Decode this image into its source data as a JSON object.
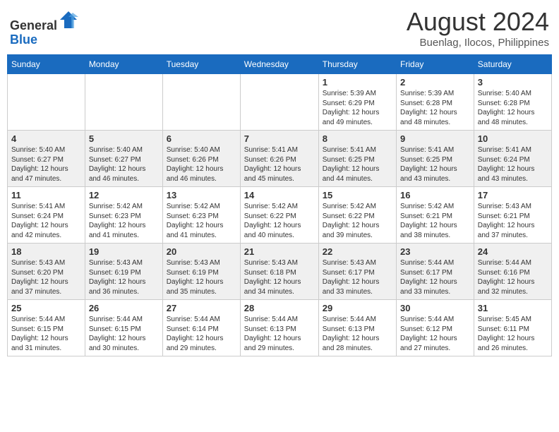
{
  "header": {
    "logo_line1": "General",
    "logo_line2": "Blue",
    "month_title": "August 2024",
    "location": "Buenlag, Ilocos, Philippines"
  },
  "weekdays": [
    "Sunday",
    "Monday",
    "Tuesday",
    "Wednesday",
    "Thursday",
    "Friday",
    "Saturday"
  ],
  "weeks": [
    [
      {
        "day": "",
        "info": ""
      },
      {
        "day": "",
        "info": ""
      },
      {
        "day": "",
        "info": ""
      },
      {
        "day": "",
        "info": ""
      },
      {
        "day": "1",
        "info": "Sunrise: 5:39 AM\nSunset: 6:29 PM\nDaylight: 12 hours\nand 49 minutes."
      },
      {
        "day": "2",
        "info": "Sunrise: 5:39 AM\nSunset: 6:28 PM\nDaylight: 12 hours\nand 48 minutes."
      },
      {
        "day": "3",
        "info": "Sunrise: 5:40 AM\nSunset: 6:28 PM\nDaylight: 12 hours\nand 48 minutes."
      }
    ],
    [
      {
        "day": "4",
        "info": "Sunrise: 5:40 AM\nSunset: 6:27 PM\nDaylight: 12 hours\nand 47 minutes."
      },
      {
        "day": "5",
        "info": "Sunrise: 5:40 AM\nSunset: 6:27 PM\nDaylight: 12 hours\nand 46 minutes."
      },
      {
        "day": "6",
        "info": "Sunrise: 5:40 AM\nSunset: 6:26 PM\nDaylight: 12 hours\nand 46 minutes."
      },
      {
        "day": "7",
        "info": "Sunrise: 5:41 AM\nSunset: 6:26 PM\nDaylight: 12 hours\nand 45 minutes."
      },
      {
        "day": "8",
        "info": "Sunrise: 5:41 AM\nSunset: 6:25 PM\nDaylight: 12 hours\nand 44 minutes."
      },
      {
        "day": "9",
        "info": "Sunrise: 5:41 AM\nSunset: 6:25 PM\nDaylight: 12 hours\nand 43 minutes."
      },
      {
        "day": "10",
        "info": "Sunrise: 5:41 AM\nSunset: 6:24 PM\nDaylight: 12 hours\nand 43 minutes."
      }
    ],
    [
      {
        "day": "11",
        "info": "Sunrise: 5:41 AM\nSunset: 6:24 PM\nDaylight: 12 hours\nand 42 minutes."
      },
      {
        "day": "12",
        "info": "Sunrise: 5:42 AM\nSunset: 6:23 PM\nDaylight: 12 hours\nand 41 minutes."
      },
      {
        "day": "13",
        "info": "Sunrise: 5:42 AM\nSunset: 6:23 PM\nDaylight: 12 hours\nand 41 minutes."
      },
      {
        "day": "14",
        "info": "Sunrise: 5:42 AM\nSunset: 6:22 PM\nDaylight: 12 hours\nand 40 minutes."
      },
      {
        "day": "15",
        "info": "Sunrise: 5:42 AM\nSunset: 6:22 PM\nDaylight: 12 hours\nand 39 minutes."
      },
      {
        "day": "16",
        "info": "Sunrise: 5:42 AM\nSunset: 6:21 PM\nDaylight: 12 hours\nand 38 minutes."
      },
      {
        "day": "17",
        "info": "Sunrise: 5:43 AM\nSunset: 6:21 PM\nDaylight: 12 hours\nand 37 minutes."
      }
    ],
    [
      {
        "day": "18",
        "info": "Sunrise: 5:43 AM\nSunset: 6:20 PM\nDaylight: 12 hours\nand 37 minutes."
      },
      {
        "day": "19",
        "info": "Sunrise: 5:43 AM\nSunset: 6:19 PM\nDaylight: 12 hours\nand 36 minutes."
      },
      {
        "day": "20",
        "info": "Sunrise: 5:43 AM\nSunset: 6:19 PM\nDaylight: 12 hours\nand 35 minutes."
      },
      {
        "day": "21",
        "info": "Sunrise: 5:43 AM\nSunset: 6:18 PM\nDaylight: 12 hours\nand 34 minutes."
      },
      {
        "day": "22",
        "info": "Sunrise: 5:43 AM\nSunset: 6:17 PM\nDaylight: 12 hours\nand 33 minutes."
      },
      {
        "day": "23",
        "info": "Sunrise: 5:44 AM\nSunset: 6:17 PM\nDaylight: 12 hours\nand 33 minutes."
      },
      {
        "day": "24",
        "info": "Sunrise: 5:44 AM\nSunset: 6:16 PM\nDaylight: 12 hours\nand 32 minutes."
      }
    ],
    [
      {
        "day": "25",
        "info": "Sunrise: 5:44 AM\nSunset: 6:15 PM\nDaylight: 12 hours\nand 31 minutes."
      },
      {
        "day": "26",
        "info": "Sunrise: 5:44 AM\nSunset: 6:15 PM\nDaylight: 12 hours\nand 30 minutes."
      },
      {
        "day": "27",
        "info": "Sunrise: 5:44 AM\nSunset: 6:14 PM\nDaylight: 12 hours\nand 29 minutes."
      },
      {
        "day": "28",
        "info": "Sunrise: 5:44 AM\nSunset: 6:13 PM\nDaylight: 12 hours\nand 29 minutes."
      },
      {
        "day": "29",
        "info": "Sunrise: 5:44 AM\nSunset: 6:13 PM\nDaylight: 12 hours\nand 28 minutes."
      },
      {
        "day": "30",
        "info": "Sunrise: 5:44 AM\nSunset: 6:12 PM\nDaylight: 12 hours\nand 27 minutes."
      },
      {
        "day": "31",
        "info": "Sunrise: 5:45 AM\nSunset: 6:11 PM\nDaylight: 12 hours\nand 26 minutes."
      }
    ]
  ]
}
